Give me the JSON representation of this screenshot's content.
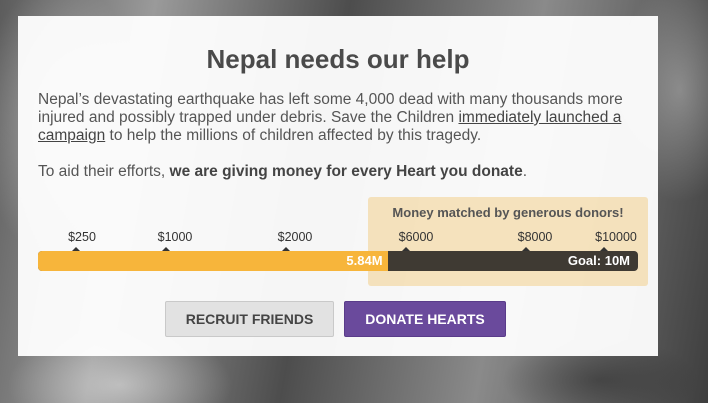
{
  "title": "Nepal needs our help",
  "intro": {
    "text_before_link": "Nepal’s devastating earthquake has left some 4,000 dead with many thousands more injured and possibly trapped under debris. Save the Children ",
    "link_text": "immediately launched a campaign",
    "text_after_link": " to help the millions of children affected by this tragedy."
  },
  "aid": {
    "text_before": "To aid their efforts, ",
    "strong_text": "we are giving money for every Heart you donate",
    "text_after": "."
  },
  "match_label": "Money matched by generous donors!",
  "progress": {
    "ticks": [
      "$250",
      "$1000",
      "$2000",
      "$6000",
      "$8000",
      "$10000"
    ],
    "raised_label": "5.84M",
    "goal_label": "Goal: 10M",
    "raised_value": 5.84,
    "goal_value": 10,
    "fill_color": "#f7b53b",
    "track_color": "#3f3a33"
  },
  "buttons": {
    "recruit_label": "Recruit Friends",
    "donate_label": "Donate Hearts",
    "donate_color": "#6a4a9c"
  }
}
